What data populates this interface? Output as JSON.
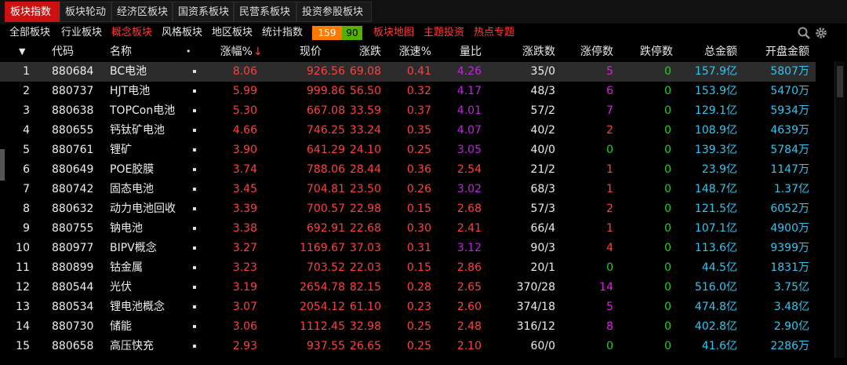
{
  "top_tabs": [
    "板块指数",
    "板块轮动",
    "经济区板块",
    "国资系板块",
    "民营系板块",
    "投资参股板块"
  ],
  "sub_nav": [
    "全部板块",
    "行业板块",
    "概念板块",
    "风格板块",
    "地区板块",
    "统计指数"
  ],
  "counts": {
    "up": "159",
    "down": "90"
  },
  "links": [
    "板块地图",
    "主题投资",
    "热点专题"
  ],
  "columns": [
    "代码",
    "名称",
    "涨幅%",
    "现价",
    "涨跌",
    "涨速%",
    "量比",
    "涨跌数",
    "涨停数",
    "跌停数",
    "总金额",
    "开盘金额"
  ],
  "sort_markers": {
    "header_arrow": "▼",
    "column_arrow": "↓",
    "dot": "•"
  },
  "rows": [
    {
      "n": "1",
      "code": "880684",
      "name": "BC电池",
      "pct": "8.06",
      "price": "926.56",
      "chg": "69.08",
      "speed": "0.41",
      "vr": "4.26",
      "updown": "35/0",
      "lu": "5",
      "ld": "0",
      "amt": "157.9亿",
      "open": "5807万"
    },
    {
      "n": "2",
      "code": "880737",
      "name": "HJT电池",
      "pct": "5.99",
      "price": "999.86",
      "chg": "56.50",
      "speed": "0.32",
      "vr": "4.17",
      "updown": "48/3",
      "lu": "6",
      "ld": "0",
      "amt": "153.9亿",
      "open": "5470万"
    },
    {
      "n": "3",
      "code": "880638",
      "name": "TOPCon电池",
      "pct": "5.30",
      "price": "667.08",
      "chg": "33.59",
      "speed": "0.37",
      "vr": "4.01",
      "updown": "57/2",
      "lu": "7",
      "ld": "0",
      "amt": "129.1亿",
      "open": "5934万"
    },
    {
      "n": "4",
      "code": "880655",
      "name": "钙钛矿电池",
      "pct": "4.66",
      "price": "746.25",
      "chg": "33.24",
      "speed": "0.35",
      "vr": "4.07",
      "updown": "40/2",
      "lu": "2",
      "ld": "0",
      "amt": "108.9亿",
      "open": "4639万"
    },
    {
      "n": "5",
      "code": "880761",
      "name": "锂矿",
      "pct": "3.90",
      "price": "641.29",
      "chg": "24.10",
      "speed": "0.25",
      "vr": "3.05",
      "updown": "40/0",
      "lu": "0",
      "ld": "0",
      "amt": "139.3亿",
      "open": "5784万"
    },
    {
      "n": "6",
      "code": "880649",
      "name": "POE胶膜",
      "pct": "3.74",
      "price": "788.06",
      "chg": "28.44",
      "speed": "0.36",
      "vr": "2.54",
      "updown": "21/2",
      "lu": "1",
      "ld": "0",
      "amt": "23.9亿",
      "open": "1147万"
    },
    {
      "n": "7",
      "code": "880742",
      "name": "固态电池",
      "pct": "3.45",
      "price": "704.81",
      "chg": "23.50",
      "speed": "0.26",
      "vr": "3.02",
      "updown": "68/3",
      "lu": "1",
      "ld": "0",
      "amt": "148.7亿",
      "open": "1.37亿"
    },
    {
      "n": "8",
      "code": "880632",
      "name": "动力电池回收",
      "pct": "3.39",
      "price": "700.57",
      "chg": "22.98",
      "speed": "0.15",
      "vr": "2.68",
      "updown": "57/3",
      "lu": "2",
      "ld": "0",
      "amt": "121.5亿",
      "open": "6052万"
    },
    {
      "n": "9",
      "code": "880755",
      "name": "钠电池",
      "pct": "3.38",
      "price": "692.91",
      "chg": "22.68",
      "speed": "0.30",
      "vr": "2.41",
      "updown": "66/4",
      "lu": "1",
      "ld": "0",
      "amt": "107.1亿",
      "open": "4900万"
    },
    {
      "n": "10",
      "code": "880977",
      "name": "BIPV概念",
      "pct": "3.27",
      "price": "1169.67",
      "chg": "37.03",
      "speed": "0.31",
      "vr": "3.12",
      "updown": "90/3",
      "lu": "4",
      "ld": "0",
      "amt": "113.6亿",
      "open": "9399万"
    },
    {
      "n": "11",
      "code": "880899",
      "name": "钴金属",
      "pct": "3.23",
      "price": "703.52",
      "chg": "22.03",
      "speed": "0.15",
      "vr": "2.86",
      "updown": "20/1",
      "lu": "0",
      "ld": "0",
      "amt": "44.5亿",
      "open": "1831万"
    },
    {
      "n": "12",
      "code": "880544",
      "name": "光伏",
      "pct": "3.19",
      "price": "2654.78",
      "chg": "82.15",
      "speed": "0.28",
      "vr": "2.65",
      "updown": "370/28",
      "lu": "14",
      "ld": "0",
      "amt": "516.0亿",
      "open": "3.75亿"
    },
    {
      "n": "13",
      "code": "880534",
      "name": "锂电池概念",
      "pct": "3.07",
      "price": "2054.12",
      "chg": "61.10",
      "speed": "0.23",
      "vr": "2.60",
      "updown": "374/18",
      "lu": "5",
      "ld": "0",
      "amt": "474.8亿",
      "open": "3.48亿"
    },
    {
      "n": "14",
      "code": "880730",
      "name": "储能",
      "pct": "3.06",
      "price": "1112.45",
      "chg": "32.98",
      "speed": "0.25",
      "vr": "2.48",
      "updown": "316/12",
      "lu": "8",
      "ld": "0",
      "amt": "402.8亿",
      "open": "2.90亿"
    },
    {
      "n": "15",
      "code": "880658",
      "name": "高压快充",
      "pct": "2.93",
      "price": "937.55",
      "chg": "26.65",
      "speed": "0.25",
      "vr": "2.10",
      "updown": "60/0",
      "lu": "0",
      "ld": "0",
      "amt": "41.6亿",
      "open": "2286万"
    }
  ],
  "colors": {
    "up": "#ff4040",
    "volume_ratio_high": "#c026e0",
    "zero": "#21d11f",
    "amount": "#2ec6f0",
    "active_tab": "#cc1111"
  },
  "icons": [
    "search-icon",
    "gear-icon",
    "row-dot-icon"
  ]
}
